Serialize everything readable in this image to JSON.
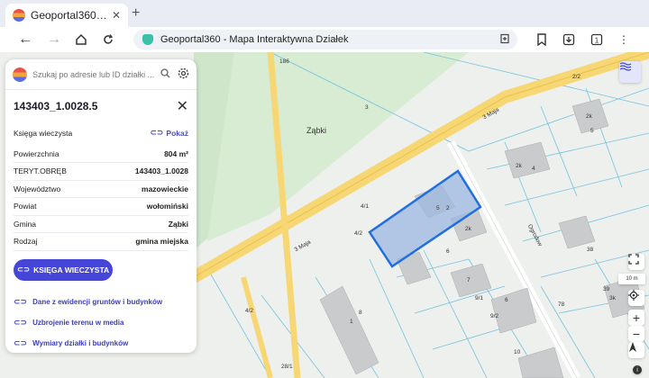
{
  "browser": {
    "tab_title": "Geoportal360…",
    "tab_close": "✕",
    "new_tab": "+",
    "url_text": "Geoportal360 - Mapa Interaktywna Działek"
  },
  "search": {
    "placeholder": "Szukaj po adresie lub ID działki ..."
  },
  "parcel": {
    "id": "143403_1.0028.5",
    "kw_label": "Księga wieczysta",
    "kw_show": "Pokaż",
    "rows": [
      {
        "label": "Powierzchnia",
        "value": "804 m²"
      },
      {
        "label": "TERYT.OBRĘB",
        "value": "143403_1.0028"
      },
      {
        "label": "Województwo",
        "value": "mazowieckie"
      },
      {
        "label": "Powiat",
        "value": "wołomiński"
      },
      {
        "label": "Gmina",
        "value": "Ząbki"
      },
      {
        "label": "Rodzaj",
        "value": "gmina miejska"
      }
    ],
    "kw_button": "KSIĘGA WIECZYSTA",
    "links": [
      "Dane z ewidencji gruntów i budynków",
      "Uzbrojenie terenu w media",
      "Wymiary działki i budynków"
    ]
  },
  "map": {
    "town": "Ząbki",
    "street_main": "3 Maja",
    "street_main_2": "3 Maja",
    "street_side": "Ogrodow",
    "scale": "10 m",
    "labels": [
      "186",
      "3",
      "2/2",
      "5",
      "4",
      "2k",
      "4/1",
      "4/2",
      "5",
      "2",
      "2k",
      "6",
      "7",
      "6",
      "9/1",
      "9/2",
      "8",
      "4/2",
      "28/1",
      "10",
      "38",
      "39",
      "78",
      "1",
      "2k",
      "3k"
    ]
  },
  "colors": {
    "accent": "#4545d8",
    "parcel_fill": "#9cb8e0",
    "parcel_stroke": "#1f6fe0",
    "road": "#f7d774"
  }
}
